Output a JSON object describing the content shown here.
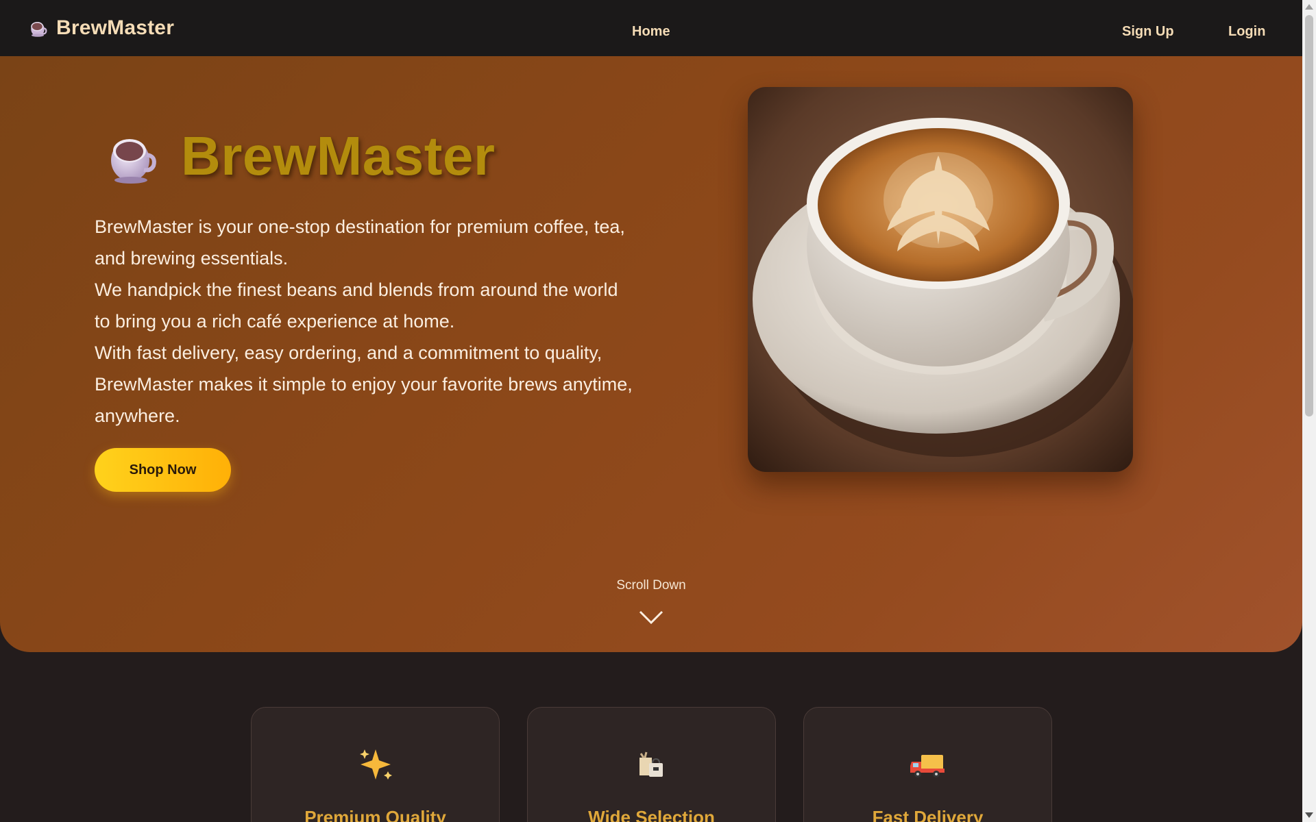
{
  "navbar": {
    "brand": "BrewMaster",
    "brand_icon": "coffee-cup-icon",
    "links": {
      "home": "Home",
      "signup": "Sign Up",
      "login": "Login"
    }
  },
  "hero": {
    "title": "BrewMaster",
    "title_icon": "coffee-cup-icon",
    "paragraphs": [
      "BrewMaster is your one-stop destination for premium coffee, tea, and brewing essentials.",
      "We handpick the finest beans and blends from around the world to bring you a rich café experience at home.",
      "With fast delivery, easy ordering, and a commitment to quality, BrewMaster makes it simple to enjoy your favorite brews anytime, anywhere."
    ],
    "cta": "Shop Now",
    "image": "latte-art-coffee-cup",
    "scroll_label": "Scroll Down",
    "scroll_icon": "chevron-down-icon"
  },
  "features": [
    {
      "icon": "sparkles-icon",
      "title": "Premium Quality"
    },
    {
      "icon": "shopping-bags-icon",
      "title": "Wide Selection"
    },
    {
      "icon": "delivery-truck-icon",
      "title": "Fast Delivery"
    }
  ],
  "colors": {
    "navbar_bg": "#1b1919",
    "hero_gradient_start": "#7a4316",
    "hero_gradient_end": "#a1522c",
    "title_gold": "#b38c0d",
    "cta_yellow": "#ffc812",
    "feature_title": "#e0a83a",
    "page_bg": "#231c1c"
  }
}
